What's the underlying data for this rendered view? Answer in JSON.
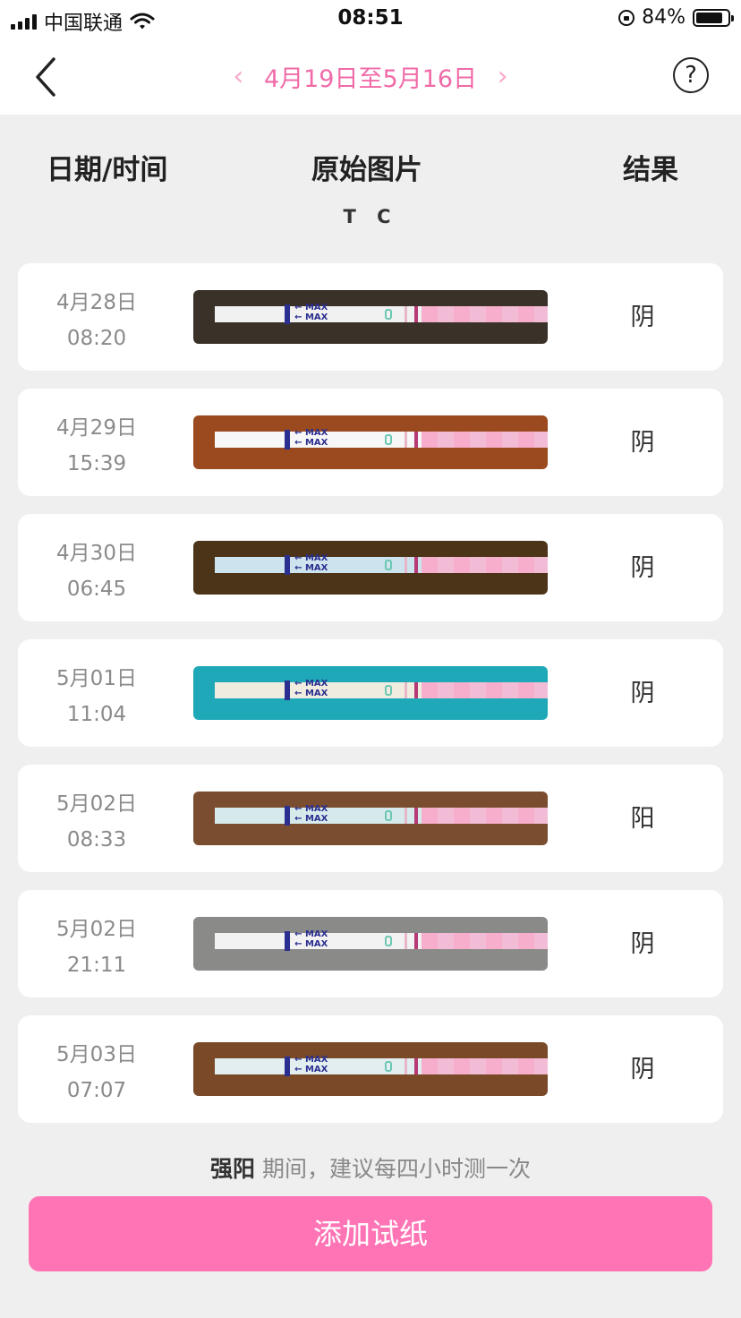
{
  "status_bar": {
    "carrier": "中国联通",
    "time": "08:51",
    "battery": "84%",
    "battery_level": 0.84
  },
  "nav": {
    "date_range": "4月19日至5月16日",
    "prev_arrow": "‹",
    "next_arrow": "›",
    "help": "?"
  },
  "headers": {
    "date_time": "日期/时间",
    "original_image": "原始图片",
    "result": "结果",
    "tc": "T C"
  },
  "records": [
    {
      "date": "4月28日",
      "time": "08:20",
      "result": "阴",
      "photo_bg": "#3a3129",
      "strip_tint": "#f1f1f1"
    },
    {
      "date": "4月29日",
      "time": "15:39",
      "result": "阴",
      "photo_bg": "#9a4a1e",
      "strip_tint": "#f7f7f7"
    },
    {
      "date": "4月30日",
      "time": "06:45",
      "result": "阴",
      "photo_bg": "#4b3418",
      "strip_tint": "#cde3ee"
    },
    {
      "date": "5月01日",
      "time": "11:04",
      "result": "阴",
      "photo_bg": "#1ea8b8",
      "strip_tint": "#f1ece0"
    },
    {
      "date": "5月02日",
      "time": "08:33",
      "result": "阳",
      "photo_bg": "#7a4d30",
      "strip_tint": "#d6eaec"
    },
    {
      "date": "5月02日",
      "time": "21:11",
      "result": "阴",
      "photo_bg": "#8a8a88",
      "strip_tint": "#f2f2f2"
    },
    {
      "date": "5月03日",
      "time": "07:07",
      "result": "阴",
      "photo_bg": "#7a4a28",
      "strip_tint": "#e2eef0"
    }
  ],
  "strip_text": {
    "max": "MAX"
  },
  "footer": {
    "hint_strong": "强阳",
    "hint_rest": " 期间，建议每四小时测一次",
    "add_button": "添加试纸"
  },
  "colors": {
    "accent": "#ff74b5",
    "date_range": "#f06ba8"
  }
}
